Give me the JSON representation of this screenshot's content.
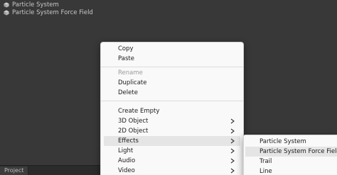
{
  "hierarchy": {
    "items": [
      {
        "label": "Particle System"
      },
      {
        "label": "Particle System Force Field"
      }
    ]
  },
  "bottom_panel": {
    "tab_label": "Project"
  },
  "context_menu": {
    "copy": "Copy",
    "paste": "Paste",
    "rename": "Rename",
    "duplicate": "Duplicate",
    "delete": "Delete",
    "create_empty": "Create Empty",
    "object_3d": "3D Object",
    "object_2d": "2D Object",
    "effects": "Effects",
    "light": "Light",
    "audio": "Audio",
    "video": "Video"
  },
  "effects_submenu": {
    "particle_system": "Particle System",
    "particle_system_force_field": "Particle System Force Field",
    "trail": "Trail",
    "line": "Line"
  },
  "icons": {
    "hierarchy_item": "cube-icon",
    "submenu_arrow": "chevron-right-icon"
  },
  "colors": {
    "editor_bg": "#383838",
    "menu_bg": "#f9f9f9",
    "menu_hover": "#e5e5e5",
    "disabled_text": "#9a9a9a"
  }
}
